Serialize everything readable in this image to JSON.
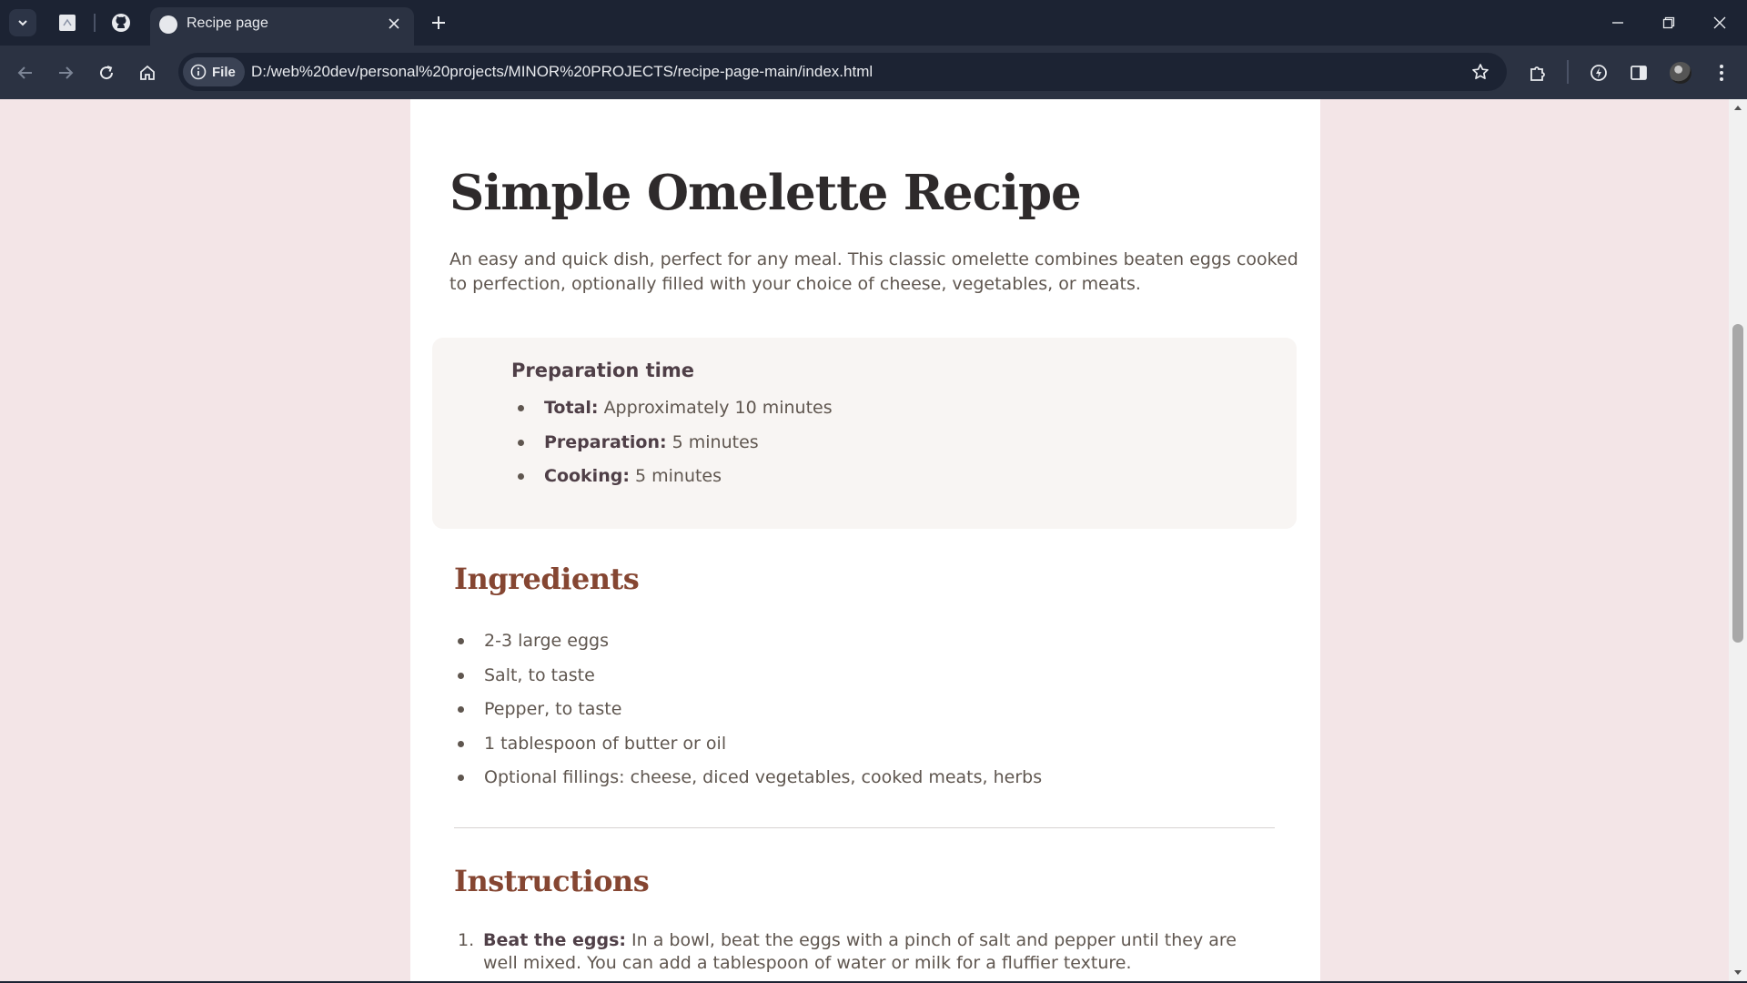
{
  "browser": {
    "tab": {
      "title": "Recipe page"
    },
    "address_bar": {
      "scheme_chip": "File",
      "url": "D:/web%20dev/personal%20projects/MINOR%20PROJECTS/recipe-page-main/index.html"
    }
  },
  "recipe": {
    "title": "Simple Omelette Recipe",
    "intro": "An easy and quick dish, perfect for any meal. This classic omelette combines beaten eggs cooked to perfection, optionally filled with your choice of cheese, vegetables, or meats.",
    "preparation": {
      "heading": "Preparation time",
      "items": [
        {
          "label": "Total:",
          "value": "Approximately 10 minutes"
        },
        {
          "label": "Preparation:",
          "value": "5 minutes"
        },
        {
          "label": "Cooking:",
          "value": "5 minutes"
        }
      ]
    },
    "ingredients": {
      "heading": "Ingredients",
      "items": [
        "2-3 large eggs",
        "Salt, to taste",
        "Pepper, to taste",
        "1 tablespoon of butter or oil",
        "Optional fillings: cheese, diced vegetables, cooked meats, herbs"
      ]
    },
    "instructions": {
      "heading": "Instructions",
      "steps": [
        {
          "number": "1.",
          "label": "Beat the eggs:",
          "text": "In a bowl, beat the eggs with a pinch of salt and pepper until they are well mixed. You can add a tablespoon of water or milk for a fluffier texture."
        }
      ]
    }
  }
}
